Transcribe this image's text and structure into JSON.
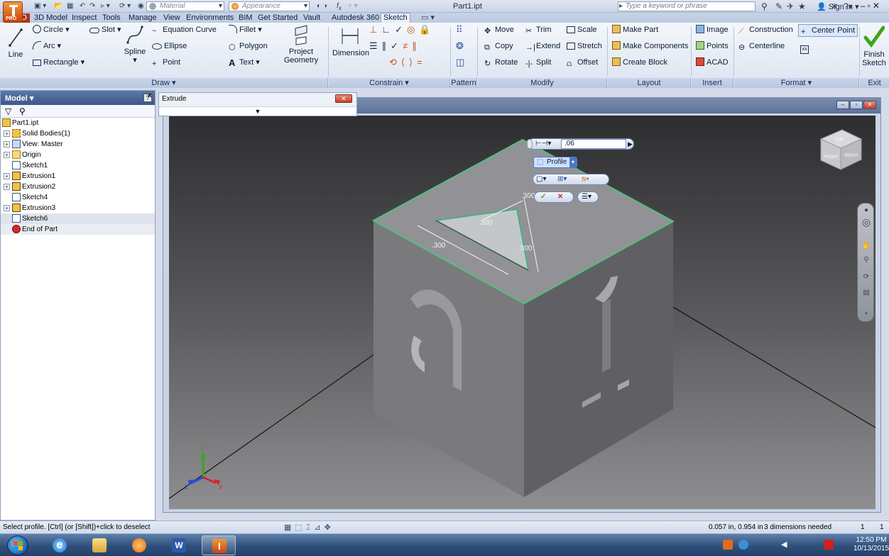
{
  "app": {
    "document_title": "Part1.ipt",
    "badge": "PRO",
    "search_placeholder": "Type a keyword or phrase",
    "sign_in": "Sign In"
  },
  "quick_access": {
    "material": "Material",
    "appearance": "Appearance"
  },
  "tabs": [
    "3D Model",
    "Inspect",
    "Tools",
    "Manage",
    "View",
    "Environments",
    "BIM",
    "Get Started",
    "Vault",
    "Autodesk 360",
    "Sketch"
  ],
  "active_tab": "Sketch",
  "ribbon": {
    "draw": {
      "line": "Line",
      "circle": "Circle",
      "arc": "Arc",
      "rectangle": "Rectangle",
      "slot": "Slot",
      "spline": "Spline",
      "equation_curve": "Equation Curve",
      "ellipse": "Ellipse",
      "point": "Point",
      "fillet": "Fillet",
      "polygon": "Polygon",
      "text": "Text",
      "project_geometry_1": "Project",
      "project_geometry_2": "Geometry"
    },
    "constrain": {
      "dimension": "Dimension"
    },
    "modify": {
      "move": "Move",
      "copy": "Copy",
      "rotate": "Rotate",
      "trim": "Trim",
      "extend": "Extend",
      "split": "Split",
      "scale": "Scale",
      "stretch": "Stretch",
      "offset": "Offset"
    },
    "layout": {
      "make_part": "Make Part",
      "make_components": "Make Components",
      "create_block": "Create Block"
    },
    "insert": {
      "image": "Image",
      "points": "Points",
      "acad": "ACAD"
    },
    "format": {
      "construction": "Construction",
      "centerline": "Centerline",
      "center_point": "Center Point"
    },
    "exit": {
      "finish_1": "Finish",
      "finish_2": "Sketch"
    },
    "panel_labels": {
      "draw": "Draw ▾",
      "constrain": "Constrain ▾",
      "pattern": "Pattern",
      "modify": "Modify",
      "layout": "Layout",
      "insert": "Insert",
      "format": "Format ▾",
      "exit": "Exit"
    }
  },
  "browser": {
    "title": "Model ▾",
    "help": "?",
    "close": "×",
    "items": [
      {
        "label": "Part1.ipt",
        "icon": "part-icon",
        "expand": ""
      },
      {
        "label": "Solid Bodies(1)",
        "icon": "solid-bodies-icon",
        "expand": "+"
      },
      {
        "label": "View: Master",
        "icon": "view-icon",
        "expand": "+"
      },
      {
        "label": "Origin",
        "icon": "folder-icon",
        "expand": "+"
      },
      {
        "label": "Sketch1",
        "icon": "sketch-icon",
        "expand": ""
      },
      {
        "label": "Extrusion1",
        "icon": "extrusion-icon",
        "expand": "+"
      },
      {
        "label": "Extrusion2",
        "icon": "extrusion-icon",
        "expand": "+"
      },
      {
        "label": "Sketch4",
        "icon": "sketch-icon",
        "expand": ""
      },
      {
        "label": "Extrusion3",
        "icon": "extrusion-icon",
        "expand": "+"
      },
      {
        "label": "Sketch6",
        "icon": "sketch-icon",
        "expand": ""
      },
      {
        "label": "End of Part",
        "icon": "end-of-part-icon",
        "expand": ""
      }
    ]
  },
  "extrude_dialog": {
    "title": "Extrude",
    "expand_glyph": "▼"
  },
  "mini_toolbar": {
    "distance": ".06",
    "profile": "Profile"
  },
  "sketch_dims": {
    "top": ".300",
    "mid": ".300",
    "left": ".300",
    "right": ".300"
  },
  "viewcube": {
    "top": "TOP",
    "front": "FRONT",
    "right": "RIGHT"
  },
  "triad": {
    "x": "X",
    "y": "Y",
    "z": "Z"
  },
  "status": {
    "message": "Select profile. [Ctrl] (or [Shift])+click to deselect",
    "coords": "0.057 in, 0.954 in",
    "dims_needed": "3 dimensions needed",
    "count_1": "1",
    "count_2": "1"
  },
  "taskbar": {
    "time": "12:50 PM",
    "date": "10/13/2015"
  },
  "colors": {
    "accent_orange": "#e4691d",
    "ribbon_blue": "#dce4f0",
    "sketch_green": "#35b57a",
    "viewport_dark": "#2e2e31"
  }
}
